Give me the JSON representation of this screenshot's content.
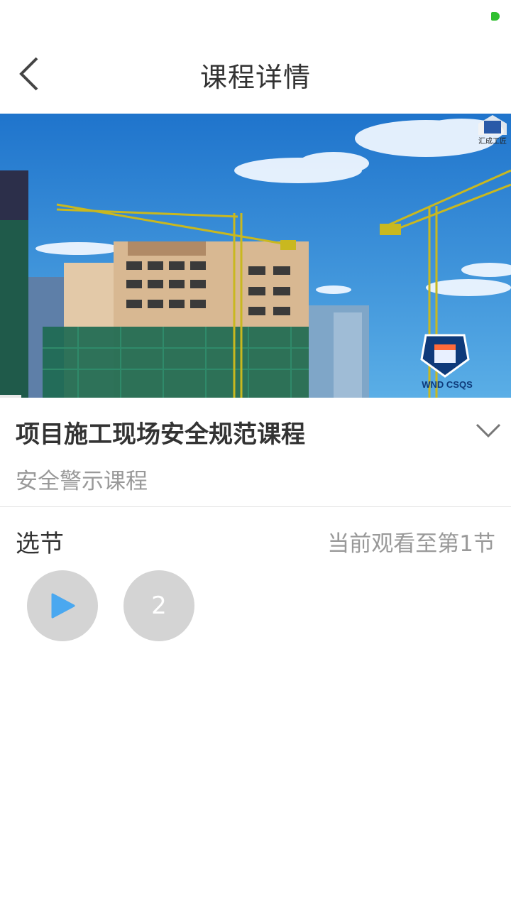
{
  "header": {
    "title": "课程详情"
  },
  "course": {
    "title": "项目施工现场安全规范课程",
    "category": "安全警示课程"
  },
  "video": {
    "watermark": "汇成工匠",
    "logo_text": "WND CSQS"
  },
  "sections": {
    "label": "选节",
    "progress_text": "当前观看至第1节",
    "episodes": [
      {
        "icon": "play-icon",
        "state": "playing"
      },
      {
        "label": "2"
      }
    ]
  },
  "colors": {
    "accent": "#4aa8f0",
    "status_dot": "#2fbf2f",
    "episode_bg": "#d4d4d4"
  }
}
